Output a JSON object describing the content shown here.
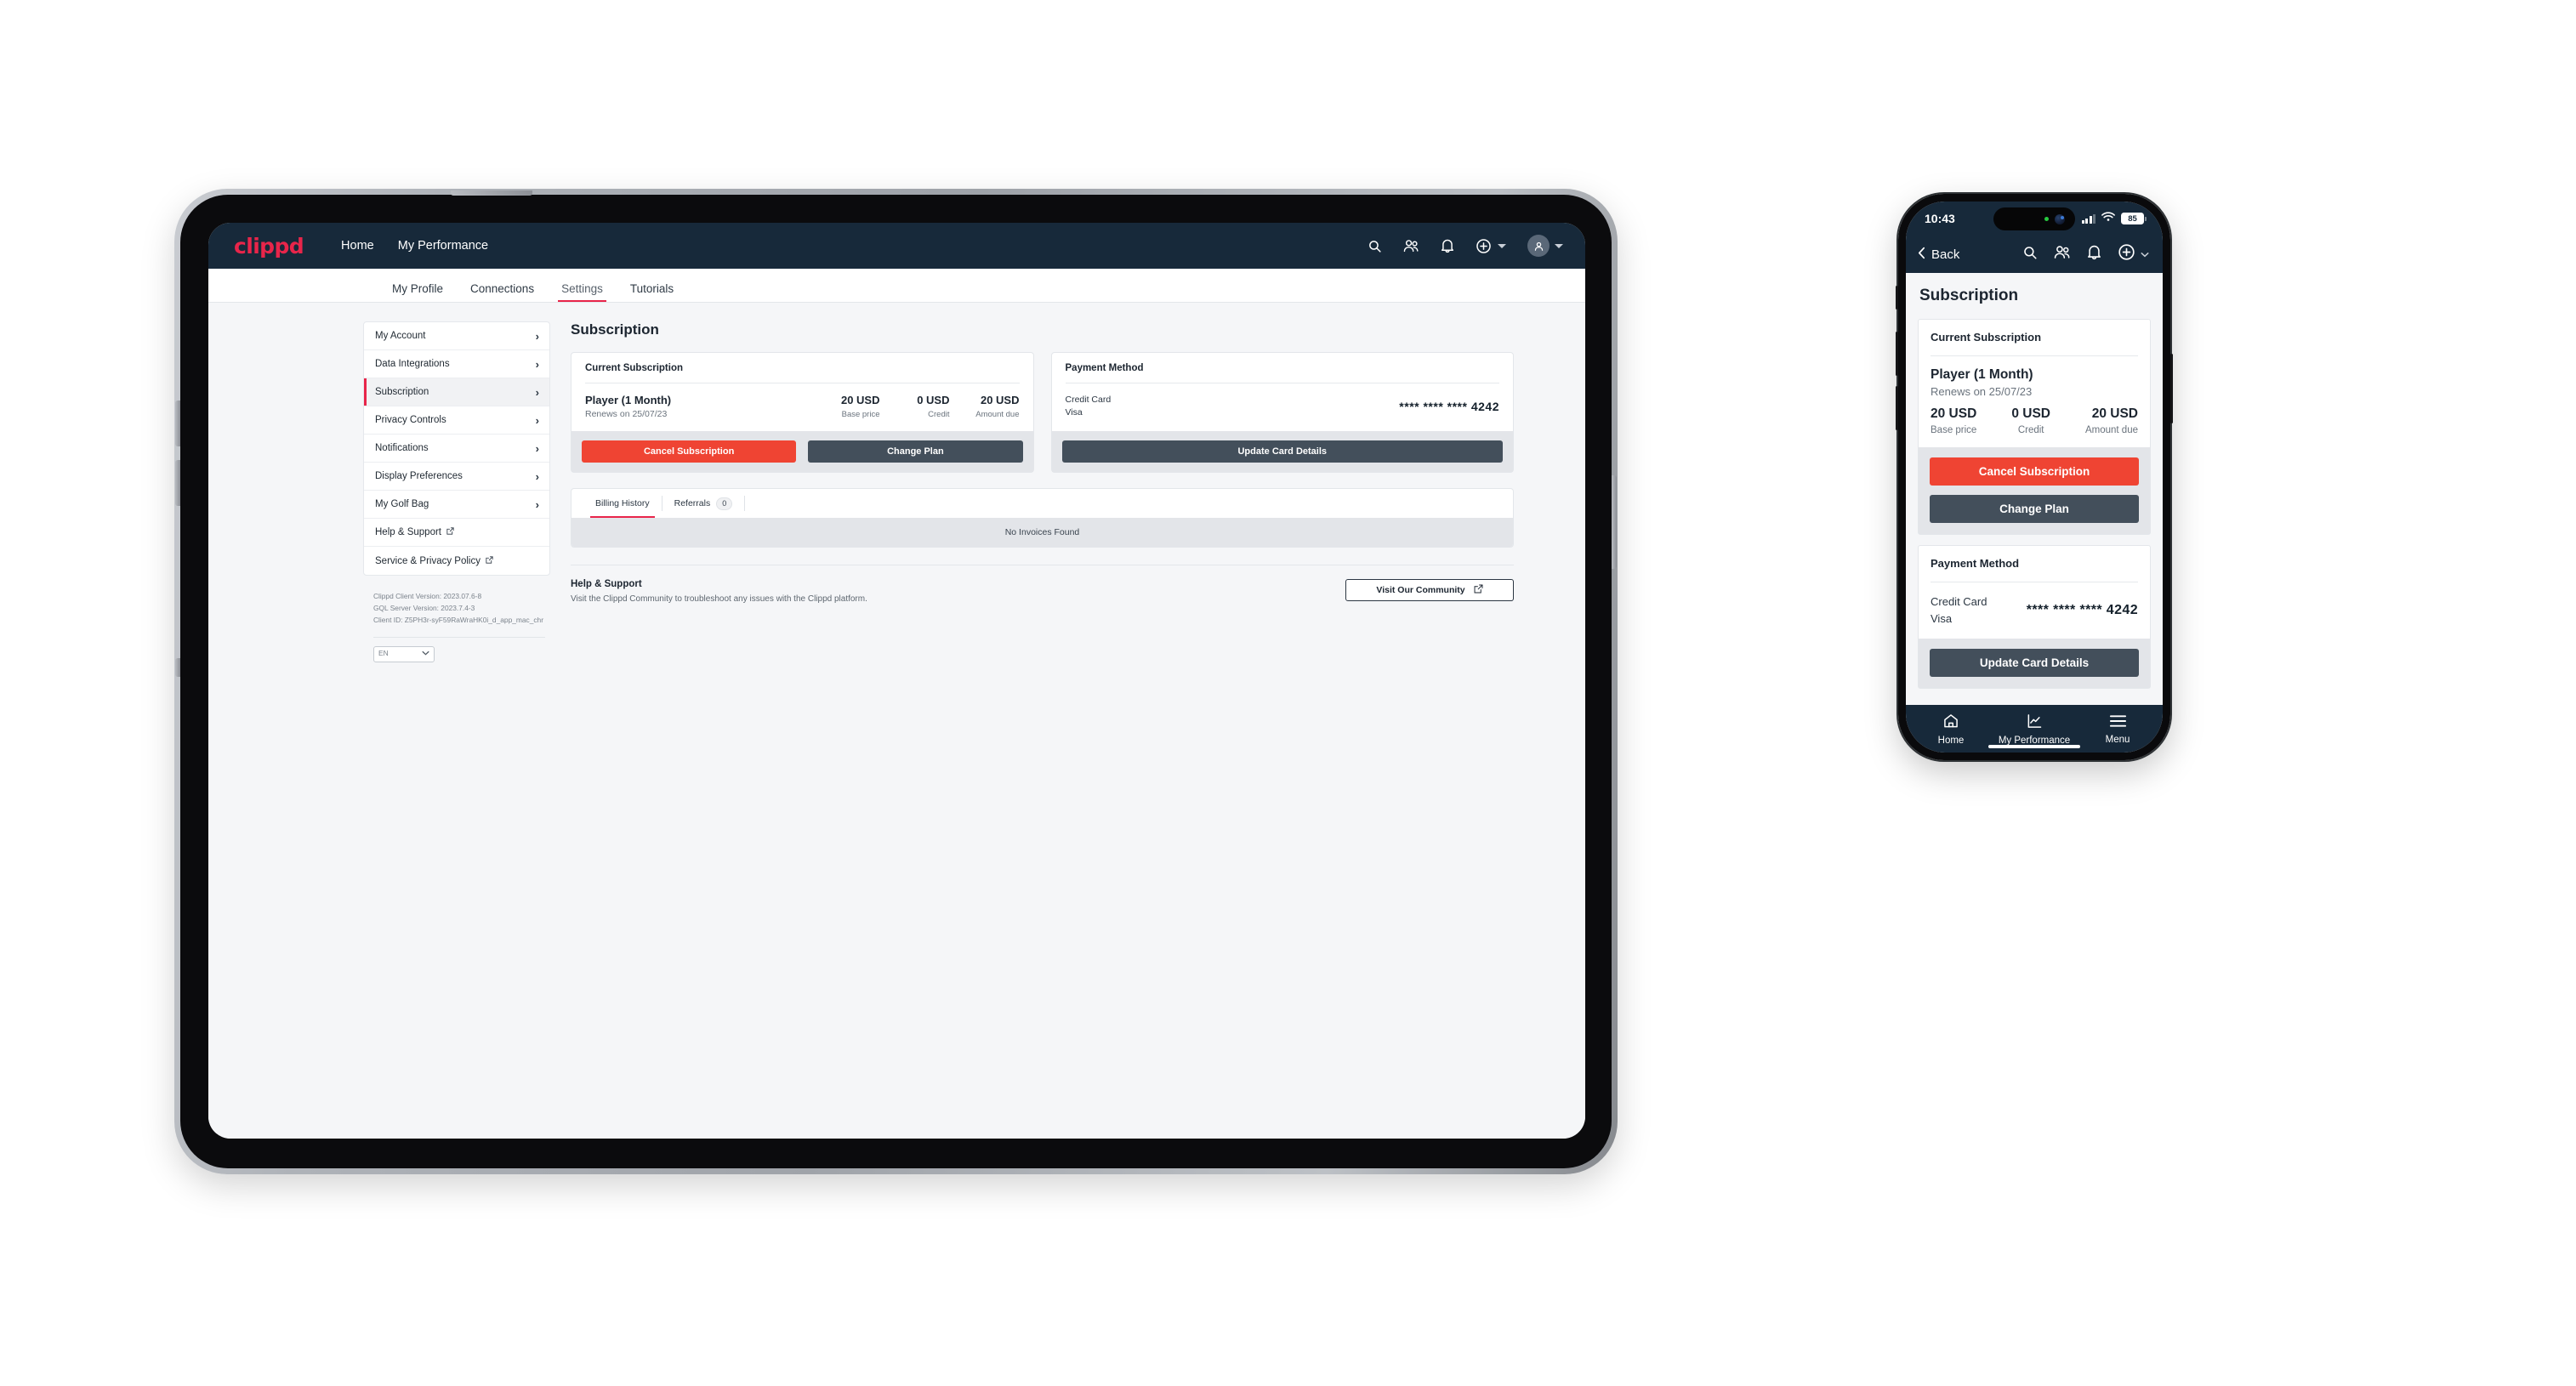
{
  "colors": {
    "navy": "#17293a",
    "accent_red": "#e8254a",
    "danger": "#ef4433",
    "dark_button": "#434f5b",
    "page_bg": "#f5f6f8"
  },
  "tablet": {
    "topnav": {
      "logo": "clippd",
      "links": [
        {
          "label": "Home"
        },
        {
          "label": "My Performance"
        }
      ],
      "icons": [
        {
          "name": "search-icon"
        },
        {
          "name": "people-icon"
        },
        {
          "name": "bell-icon"
        },
        {
          "name": "plus-circle-icon"
        },
        {
          "name": "avatar-icon"
        }
      ]
    },
    "tabs": [
      {
        "label": "My Profile",
        "active": false
      },
      {
        "label": "Connections",
        "active": false
      },
      {
        "label": "Settings",
        "active": true
      },
      {
        "label": "Tutorials",
        "active": false
      }
    ],
    "sidebar": {
      "items": [
        {
          "label": "My Account",
          "active": false,
          "external": false
        },
        {
          "label": "Data Integrations",
          "active": false,
          "external": false
        },
        {
          "label": "Subscription",
          "active": true,
          "external": false
        },
        {
          "label": "Privacy Controls",
          "active": false,
          "external": false
        },
        {
          "label": "Notifications",
          "active": false,
          "external": false
        },
        {
          "label": "Display Preferences",
          "active": false,
          "external": false
        },
        {
          "label": "My Golf Bag",
          "active": false,
          "external": false
        },
        {
          "label": "Help & Support",
          "active": false,
          "external": true
        },
        {
          "label": "Service & Privacy Policy",
          "active": false,
          "external": true
        }
      ],
      "versions": {
        "client_version": "Clippd Client Version: 2023.07.6-8",
        "gql_version": "GQL Server Version: 2023.7.4-3",
        "client_id": "Client ID: Z5PH3r-syF59RaWraHK0i_d_app_mac_chr"
      },
      "language": {
        "value": "EN",
        "options": [
          "EN"
        ]
      }
    },
    "main": {
      "page_title": "Subscription",
      "current_subscription": {
        "heading": "Current Subscription",
        "plan_name": "Player (1 Month)",
        "renews_text": "Renews on 25/07/23",
        "metrics": [
          {
            "value": "20 USD",
            "label": "Base price"
          },
          {
            "value": "0 USD",
            "label": "Credit"
          },
          {
            "value": "20 USD",
            "label": "Amount due"
          }
        ],
        "cancel_label": "Cancel Subscription",
        "change_plan_label": "Change Plan"
      },
      "payment_method": {
        "heading": "Payment Method",
        "type": "Credit Card",
        "brand": "Visa",
        "masked_number": "**** **** **** 4242",
        "update_label": "Update Card Details"
      },
      "billing": {
        "tabs": [
          {
            "label": "Billing History",
            "active": true,
            "badge": null
          },
          {
            "label": "Referrals",
            "active": false,
            "badge": "0"
          }
        ],
        "empty_text": "No Invoices Found"
      },
      "help": {
        "heading": "Help & Support",
        "description": "Visit the Clippd Community to troubleshoot any issues with the Clippd platform.",
        "button_label": "Visit Our Community"
      }
    }
  },
  "phone": {
    "status_bar": {
      "time": "10:43",
      "battery": "85",
      "signal_icon": "cellular-bars-icon",
      "wifi_icon": "wifi-icon"
    },
    "header": {
      "back_label": "Back",
      "icons": [
        {
          "name": "search-icon"
        },
        {
          "name": "people-icon"
        },
        {
          "name": "bell-icon"
        },
        {
          "name": "plus-circle-icon"
        }
      ]
    },
    "page_title": "Subscription",
    "current_subscription": {
      "heading": "Current Subscription",
      "plan_name": "Player (1 Month)",
      "renews_text": "Renews on 25/07/23",
      "metrics": [
        {
          "value": "20 USD",
          "label": "Base price"
        },
        {
          "value": "0 USD",
          "label": "Credit"
        },
        {
          "value": "20 USD",
          "label": "Amount due"
        }
      ],
      "cancel_label": "Cancel Subscription",
      "change_plan_label": "Change Plan"
    },
    "payment_method": {
      "heading": "Payment Method",
      "type": "Credit Card",
      "brand": "Visa",
      "masked_number": "**** **** **** 4242",
      "update_label": "Update Card Details"
    },
    "tabbar": [
      {
        "label": "Home",
        "icon": "home-icon"
      },
      {
        "label": "My Performance",
        "icon": "chart-icon"
      },
      {
        "label": "Menu",
        "icon": "hamburger-icon"
      }
    ]
  }
}
